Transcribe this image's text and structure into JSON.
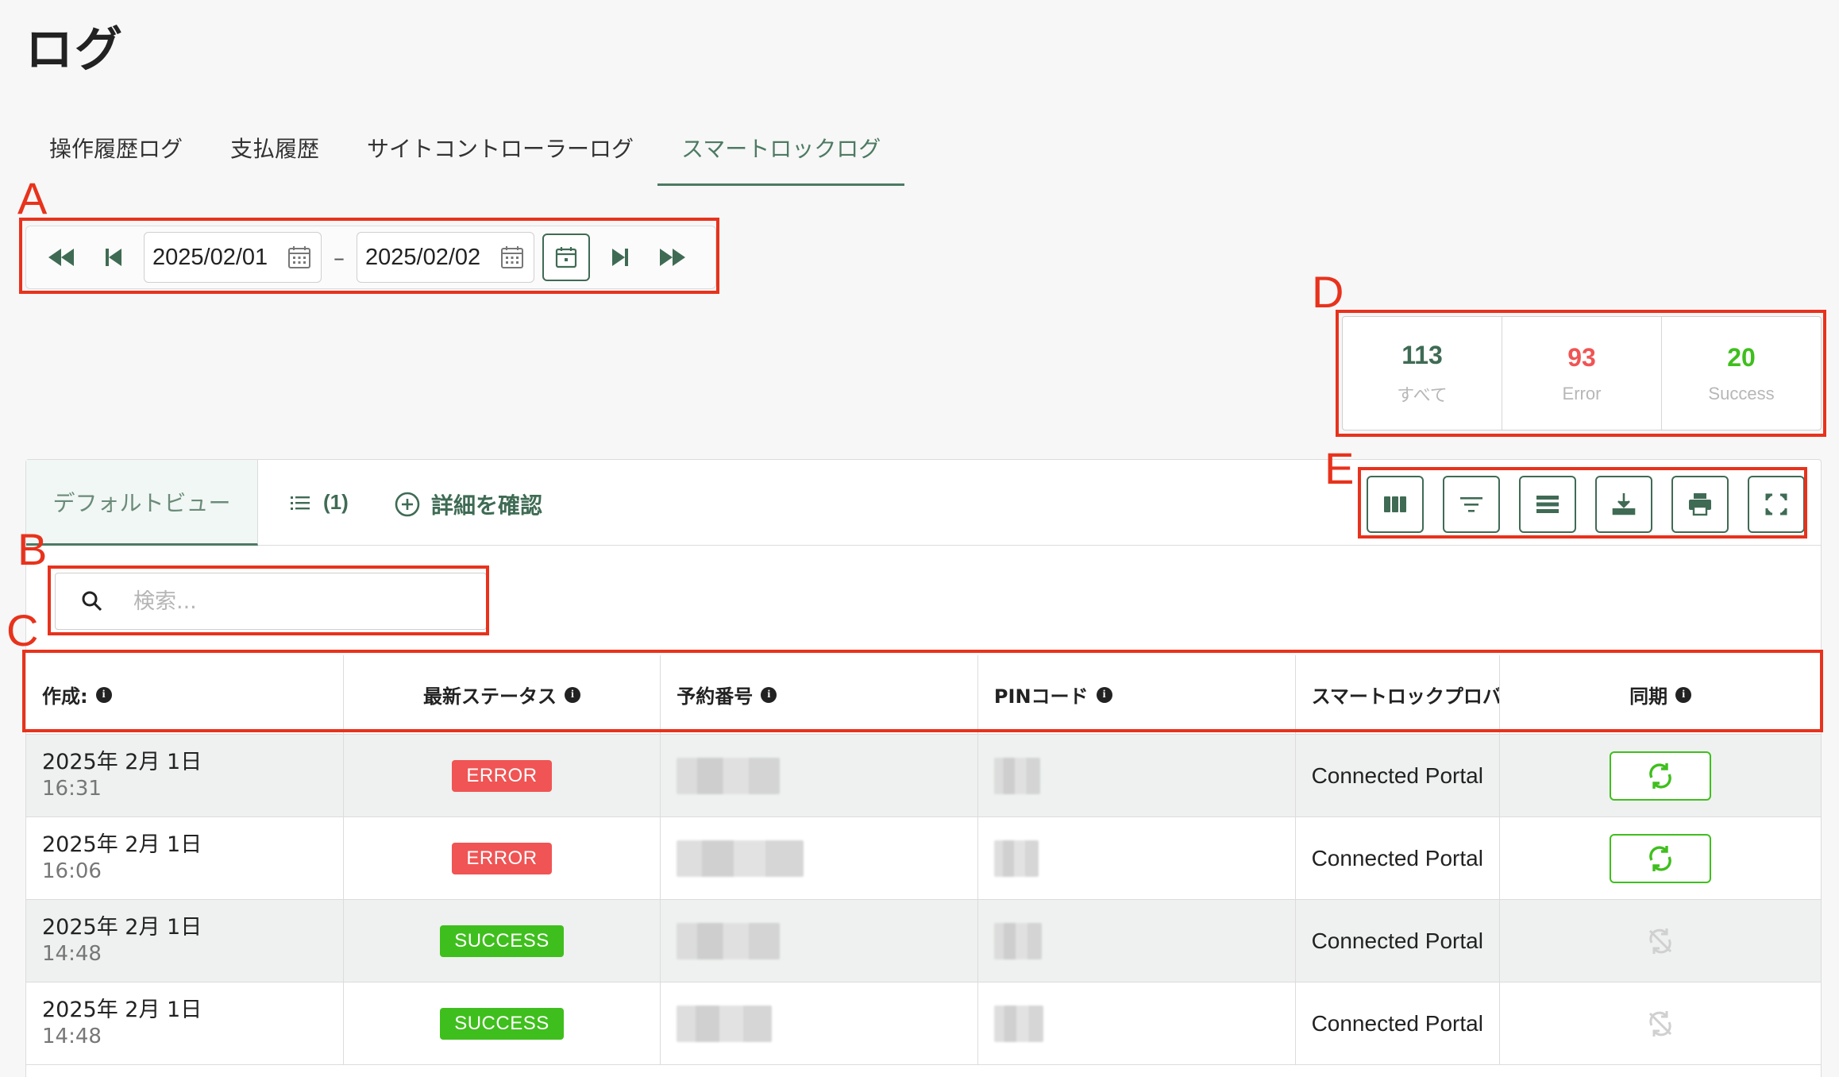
{
  "page": {
    "title": "ログ"
  },
  "main_tabs": [
    {
      "label": "操作履歴ログ",
      "active": false
    },
    {
      "label": "支払履歴",
      "active": false
    },
    {
      "label": "サイトコントローラーログ",
      "active": false
    },
    {
      "label": "スマートロックログ",
      "active": true
    }
  ],
  "annotations": {
    "a": "A",
    "b": "B",
    "c": "C",
    "d": "D",
    "e": "E"
  },
  "date_range": {
    "start": "2025/02/01",
    "separator": "–",
    "end": "2025/02/02"
  },
  "stats": [
    {
      "value": "113",
      "label": "すべて",
      "color": "#3f6b54"
    },
    {
      "value": "93",
      "label": "Error",
      "color": "#f05454"
    },
    {
      "value": "20",
      "label": "Success",
      "color": "#3fbf1d"
    }
  ],
  "view_tabs": {
    "default_label": "デフォルトビュー",
    "list_count": "(1)",
    "detail_label": "詳細を確認"
  },
  "search": {
    "placeholder": "検索..."
  },
  "table": {
    "columns": [
      "作成:",
      "最新ステータス",
      "予約番号",
      "PINコード",
      "スマートロックプロバ",
      "同期"
    ],
    "rows": [
      {
        "date": "2025年 2月 1日",
        "time": "16:31",
        "status": "ERROR",
        "provider": "Connected Portal",
        "sync": true
      },
      {
        "date": "2025年 2月 1日",
        "time": "16:06",
        "status": "ERROR",
        "provider": "Connected Portal",
        "sync": true
      },
      {
        "date": "2025年 2月 1日",
        "time": "14:48",
        "status": "SUCCESS",
        "provider": "Connected Portal",
        "sync": false
      },
      {
        "date": "2025年 2月 1日",
        "time": "14:48",
        "status": "SUCCESS",
        "provider": "Connected Portal",
        "sync": false
      }
    ]
  },
  "colors": {
    "accent": "#3f6b54",
    "error": "#f05454",
    "success": "#3fbf1d",
    "annotation": "#e8321c"
  },
  "icons": [
    "fast-rewind-icon",
    "skip-previous-icon",
    "calendar-icon",
    "skip-next-icon",
    "fast-forward-icon",
    "list-icon",
    "add-circle-icon",
    "columns-icon",
    "filter-icon",
    "density-icon",
    "download-icon",
    "print-icon",
    "fullscreen-icon",
    "search-icon",
    "info-icon",
    "sync-icon",
    "sync-disabled-icon"
  ]
}
